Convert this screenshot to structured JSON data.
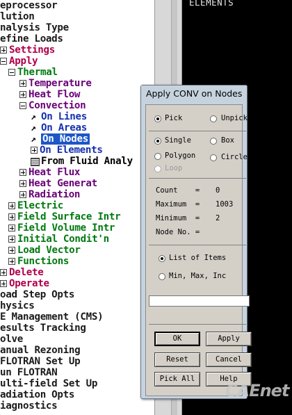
{
  "graphics": {
    "title": "ELEMENTS"
  },
  "tree": [
    {
      "label": "eprocessor",
      "color": "dark",
      "indent": 0,
      "icon": "none"
    },
    {
      "label": "lution",
      "color": "dark",
      "indent": 0,
      "icon": "none"
    },
    {
      "label": "nalysis Type",
      "color": "dark",
      "indent": 0,
      "icon": "none"
    },
    {
      "label": "efine Loads",
      "color": "dark",
      "indent": 0,
      "icon": "none"
    },
    {
      "label": "Settings",
      "color": "red",
      "indent": 0,
      "icon": "plus"
    },
    {
      "label": "Apply",
      "color": "red",
      "indent": 0,
      "icon": "minus"
    },
    {
      "label": "Thermal",
      "color": "green",
      "indent": 1,
      "icon": "minus"
    },
    {
      "label": "Temperature",
      "color": "purple",
      "indent": 2,
      "icon": "plus"
    },
    {
      "label": "Heat Flow",
      "color": "purple",
      "indent": 2,
      "icon": "plus"
    },
    {
      "label": "Convection",
      "color": "purple",
      "indent": 2,
      "icon": "minus"
    },
    {
      "label": "On Lines",
      "color": "blue",
      "indent": 3,
      "icon": "arrow"
    },
    {
      "label": "On Areas",
      "color": "blue",
      "indent": 3,
      "icon": "arrow"
    },
    {
      "label": "On Nodes",
      "color": "blue",
      "indent": 3,
      "icon": "arrow",
      "selected": true
    },
    {
      "label": "On Elements",
      "color": "blue",
      "indent": 3,
      "icon": "plus"
    },
    {
      "label": "From Fluid Analy",
      "color": "black",
      "indent": 3,
      "icon": "grid"
    },
    {
      "label": "Heat Flux",
      "color": "purple",
      "indent": 2,
      "icon": "plus"
    },
    {
      "label": "Heat Generat",
      "color": "purple",
      "indent": 2,
      "icon": "plus"
    },
    {
      "label": "Radiation",
      "color": "purple",
      "indent": 2,
      "icon": "plus"
    },
    {
      "label": "Electric",
      "color": "green",
      "indent": 1,
      "icon": "plus"
    },
    {
      "label": "Field Surface Intr",
      "color": "green",
      "indent": 1,
      "icon": "plus"
    },
    {
      "label": "Field Volume Intr",
      "color": "green",
      "indent": 1,
      "icon": "plus"
    },
    {
      "label": "Initial Condit'n",
      "color": "green",
      "indent": 1,
      "icon": "plus"
    },
    {
      "label": "Load Vector",
      "color": "green",
      "indent": 1,
      "icon": "plus"
    },
    {
      "label": "Functions",
      "color": "green",
      "indent": 1,
      "icon": "plus"
    },
    {
      "label": "Delete",
      "color": "red",
      "indent": 0,
      "icon": "plus"
    },
    {
      "label": "Operate",
      "color": "red",
      "indent": 0,
      "icon": "plus"
    },
    {
      "label": "oad Step Opts",
      "color": "dark",
      "indent": 0,
      "icon": "none"
    },
    {
      "label": "hysics",
      "color": "dark",
      "indent": 0,
      "icon": "none"
    },
    {
      "label": "E Management (CMS)",
      "color": "dark",
      "indent": 0,
      "icon": "none"
    },
    {
      "label": "esults Tracking",
      "color": "dark",
      "indent": 0,
      "icon": "none"
    },
    {
      "label": "olve",
      "color": "dark",
      "indent": 0,
      "icon": "none"
    },
    {
      "label": "anual Rezoning",
      "color": "dark",
      "indent": 0,
      "icon": "none"
    },
    {
      "label": "FLOTRAN Set Up",
      "color": "dark",
      "indent": 0,
      "icon": "none"
    },
    {
      "label": "un FLOTRAN",
      "color": "dark",
      "indent": 0,
      "icon": "none"
    },
    {
      "label": "ulti-field Set Up",
      "color": "dark",
      "indent": 0,
      "icon": "none"
    },
    {
      "label": "adiation Opts",
      "color": "dark",
      "indent": 0,
      "icon": "none"
    },
    {
      "label": "iagnostics",
      "color": "dark",
      "indent": 0,
      "icon": "none"
    }
  ],
  "dialog": {
    "title": "Apply CONV on Nodes",
    "pick": "Pick",
    "unpick": "Unpick",
    "single": "Single",
    "box": "Box",
    "polygon": "Polygon",
    "circle": "Circle",
    "loop": "Loop",
    "count_label": "Count    =",
    "count_value": "0",
    "max_label": "Maximum  =",
    "max_value": "1003",
    "min_label": "Minimum  =",
    "min_value": "2",
    "node_label": "Node No. =",
    "list_items": "List of Items",
    "min_max_inc": "Min, Max, Inc",
    "input_value": "",
    "ok": "OK",
    "apply": "Apply",
    "reset": "Reset",
    "cancel": "Cancel",
    "pick_all": "Pick All",
    "help": "Help"
  },
  "watermark": "CAEnet",
  "colors": {
    "dark": "#1a1a1a",
    "red": "#b0004a",
    "green": "#007a10",
    "purple": "#6a0078",
    "blue": "#1530b0",
    "black": "#000000",
    "selection": "#1c56c8",
    "dialog_bg": "#c6d3df"
  }
}
